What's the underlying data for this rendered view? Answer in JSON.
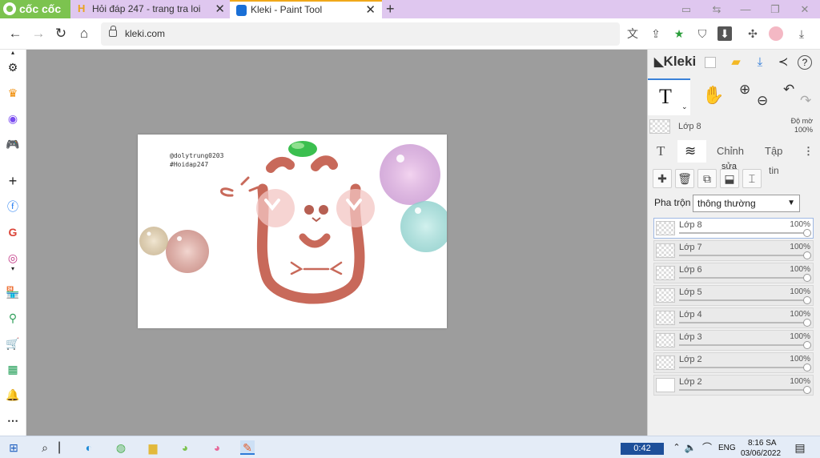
{
  "browser": {
    "brand": "cốc cốc",
    "tabs": [
      {
        "title": "Hỏi đáp 247 - trang tra loi",
        "active": false
      },
      {
        "title": "Kleki - Paint Tool",
        "active": true
      }
    ],
    "new_tab_symbol": "+",
    "url": "kleki.com",
    "colors": {
      "tabbar": "#dfc7ef",
      "brand": "#7cc34f",
      "accent": "#f0a81a"
    }
  },
  "sidebar": {
    "icons": [
      "gear-icon",
      "crown-icon",
      "messenger-icon",
      "gamepad-icon",
      "plus-icon",
      "facebook-icon",
      "google-icon",
      "instagram-icon",
      "shop-icon",
      "map-icon",
      "cart-icon",
      "sheet-icon",
      "bell-icon",
      "more-icon"
    ]
  },
  "canvas": {
    "text_lines": [
      "@dolytrung0203",
      "#Hoidap247"
    ]
  },
  "kleki": {
    "logo": "Kleki",
    "tool_letter": "T",
    "current_layer": "Lớp 8",
    "opacity_label": "Độ mờ",
    "opacity_value": "100%",
    "subtabs": {
      "text": "T",
      "adjust": "Chỉnh",
      "file": "Tập"
    },
    "tooltip": "sửa",
    "info_word": "tin",
    "blend_label": "Pha trộn",
    "blend_value": "thông thường",
    "layers": [
      {
        "name": "Lớp 8",
        "opacity": "100%",
        "selected": true
      },
      {
        "name": "Lớp 7",
        "opacity": "100%",
        "selected": false
      },
      {
        "name": "Lớp 6",
        "opacity": "100%",
        "selected": false
      },
      {
        "name": "Lớp 5",
        "opacity": "100%",
        "selected": false
      },
      {
        "name": "Lớp 4",
        "opacity": "100%",
        "selected": false
      },
      {
        "name": "Lớp 3",
        "opacity": "100%",
        "selected": false
      },
      {
        "name": "Lớp 2",
        "opacity": "100%",
        "selected": false
      },
      {
        "name": "Lớp 2",
        "opacity": "100%",
        "selected": false
      }
    ]
  },
  "taskbar": {
    "timer": "0:42",
    "language": "ENG",
    "time": "8:16 SA",
    "date": "03/06/2022"
  }
}
